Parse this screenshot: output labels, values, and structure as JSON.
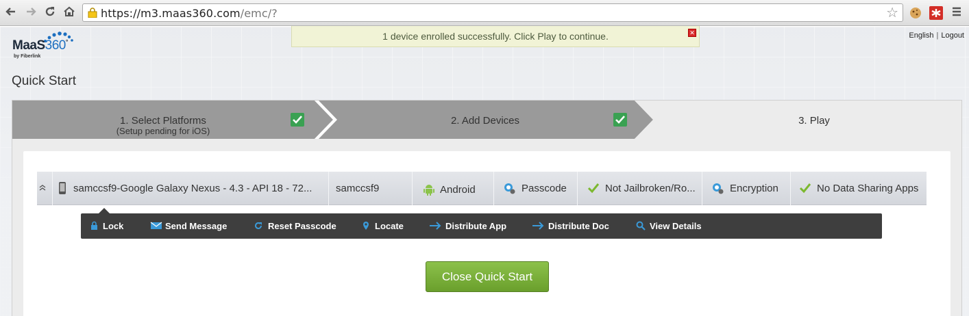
{
  "browser": {
    "url_host": "https://m3.maas360.com",
    "url_path": "/emc/?"
  },
  "logo": {
    "brand": "MaaS",
    "number": "360",
    "sub": "by Fiberlink"
  },
  "notification": {
    "message": "1 device enrolled successfully. Click Play to continue."
  },
  "top_links": {
    "language": "English",
    "separator": "|",
    "logout": "Logout"
  },
  "page": {
    "title": "Quick Start"
  },
  "wizard": {
    "steps": [
      {
        "label": "1. Select Platforms",
        "sub": "(Setup pending for iOS)",
        "done": true
      },
      {
        "label": "2. Add Devices",
        "done": true
      },
      {
        "label": "3. Play",
        "done": false
      }
    ]
  },
  "device": {
    "name": "samccsf9-Google Galaxy Nexus - 4.3 - API 18 - 72...",
    "user": "samccsf9",
    "platform": "Android",
    "passcode": "Passcode",
    "jailbreak": "Not Jailbroken/Ro...",
    "encryption": "Encryption",
    "data_sharing": "No Data Sharing Apps"
  },
  "actions": [
    {
      "label": "Lock",
      "icon": "lock-icon"
    },
    {
      "label": "Send Message",
      "icon": "envelope-icon"
    },
    {
      "label": "Reset Passcode",
      "icon": "refresh-icon"
    },
    {
      "label": "Locate",
      "icon": "map-pin-icon"
    },
    {
      "label": "Distribute App",
      "icon": "arrow-right-icon"
    },
    {
      "label": "Distribute Doc",
      "icon": "arrow-right-icon"
    },
    {
      "label": "View Details",
      "icon": "search-icon"
    }
  ],
  "buttons": {
    "close_quick_start": "Close Quick Start"
  },
  "colors": {
    "accent_green": "#6a9f2c",
    "step_active_bg": "#9a9a9a",
    "action_bar_bg": "#3e3e3e",
    "icon_blue": "#3a9ad9"
  }
}
